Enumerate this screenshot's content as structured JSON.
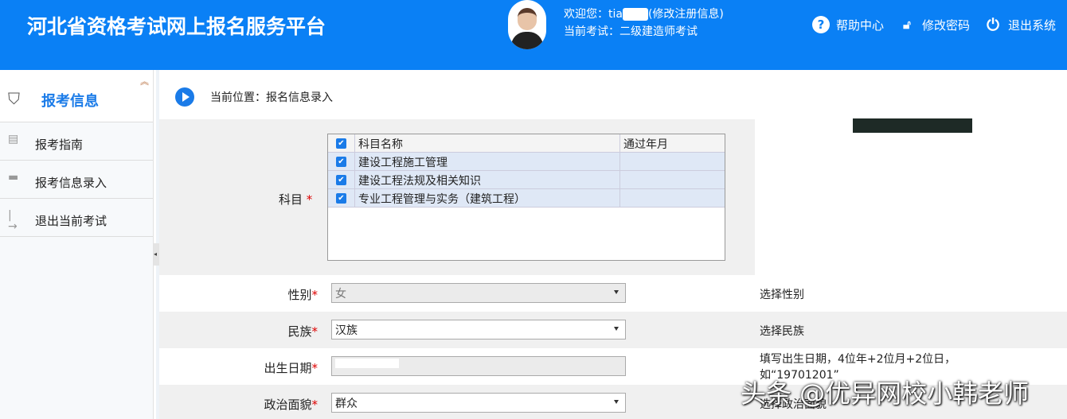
{
  "header": {
    "title": "河北省资格考试网上报名服务平台",
    "welcome_prefix": "欢迎您：tia",
    "welcome_suffix": "(修改注册信息)",
    "current_exam": "当前考试：二级建造师考试",
    "links": [
      {
        "label": "帮助中心",
        "icon": "help-icon"
      },
      {
        "label": "修改密码",
        "icon": "lock-icon"
      },
      {
        "label": "退出系统",
        "icon": "power-icon"
      }
    ]
  },
  "sidebar": {
    "title": "报考信息",
    "items": [
      {
        "label": "报考指南",
        "icon": "list-icon"
      },
      {
        "label": "报考信息录入",
        "icon": "form-icon"
      },
      {
        "label": "退出当前考试",
        "icon": "exit-icon"
      }
    ]
  },
  "breadcrumb": "当前位置：报名信息录入",
  "form": {
    "subject": {
      "label": "科目",
      "headers": [
        "科目名称",
        "通过年月"
      ],
      "rows": [
        {
          "name": "建设工程施工管理",
          "year": "",
          "checked": true
        },
        {
          "name": "建设工程法规及相关知识",
          "year": "",
          "checked": true
        },
        {
          "name": "专业工程管理与实务（建筑工程）",
          "year": "",
          "checked": true
        }
      ]
    },
    "gender": {
      "label": "性别",
      "value": "女",
      "hint": "选择性别"
    },
    "ethnicity": {
      "label": "民族",
      "value": "汉族",
      "hint": "选择民族"
    },
    "birthdate": {
      "label": "出生日期",
      "value": "",
      "hint": "填写出生日期，4位年+2位月+2位日，如“19701201”"
    },
    "politics": {
      "label": "政治面貌",
      "value": "群众",
      "hint": "选择政治面貌"
    }
  },
  "watermark": "头条 @优异网校小韩老师"
}
